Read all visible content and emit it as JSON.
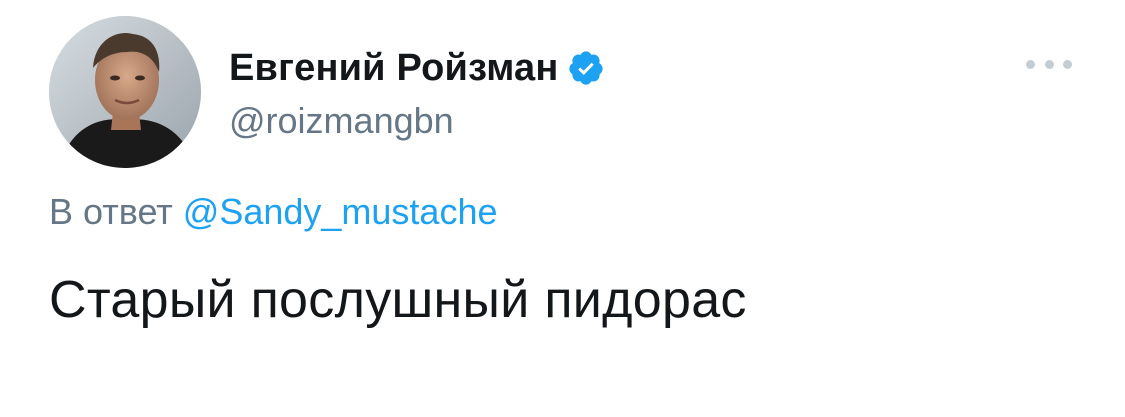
{
  "tweet": {
    "author": {
      "display_name": "Евгений Ройзман",
      "handle": "@roizmangbn",
      "verified": true,
      "avatar": "profile-photo"
    },
    "reply_to": {
      "prefix": "В ответ",
      "mention": "@Sandy_mustache"
    },
    "text": "Старый послушный пидорас",
    "more_icon": "ellipsis-icon"
  },
  "colors": {
    "text_primary": "#14171a",
    "text_secondary": "#657786",
    "link": "#1da1f2",
    "verified_badge": "#1da1f2",
    "more_dots": "#c4cdd3"
  }
}
